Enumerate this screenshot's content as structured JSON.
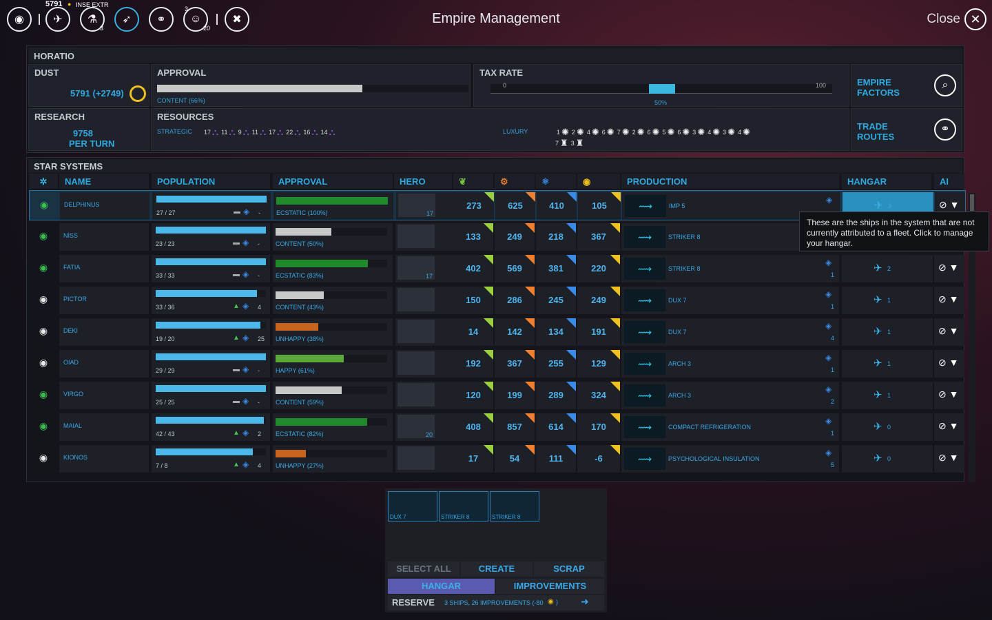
{
  "header": {
    "title": "Empire Management",
    "close_label": "Close",
    "dust_top": "5791",
    "top_tag": "INSE EXTR",
    "badge1": "3",
    "badge2": "3",
    "badge3": "20"
  },
  "empire": {
    "name": "HORATIO",
    "dust": {
      "label": "DUST",
      "value": "5791 (+2749)"
    },
    "approval": {
      "label": "APPROVAL",
      "status": "CONTENT (66%)",
      "level": 0.66
    },
    "tax": {
      "label": "TAX RATE",
      "min": "0",
      "max": "100",
      "value": "50%",
      "level": 0.5
    },
    "research": {
      "label": "RESEARCH",
      "value": "9758",
      "per_turn": "PER TURN"
    },
    "resources": {
      "label": "RESOURCES",
      "strategic_label": "STRATEGIC",
      "luxury_label": "LUXURY",
      "strategic": [
        "17",
        "11",
        "9",
        "11",
        "17",
        "22",
        "16",
        "14"
      ],
      "luxury_row1": [
        "1",
        "2",
        "4",
        "6",
        "7",
        "2",
        "6",
        "5",
        "6",
        "3",
        "4",
        "3",
        "4"
      ],
      "luxury_row2": [
        "7",
        "3"
      ]
    },
    "empire_factors": "EMPIRE FACTORS",
    "trade_routes": "TRADE ROUTES"
  },
  "systems": {
    "label": "STAR SYSTEMS",
    "columns": {
      "name": "NAME",
      "population": "POPULATION",
      "approval": "APPROVAL",
      "hero": "HERO",
      "production": "PRODUCTION",
      "hangar": "HANGAR",
      "ai": "AI"
    },
    "rows": [
      {
        "name": "DELPHINUS",
        "pop": "27 / 27",
        "pop_level": 1.0,
        "growth": "-",
        "appr": "ECSTATIC (100%)",
        "appr_level": 1.0,
        "appr_color": "#1f8a2a",
        "hero": "17",
        "food": "273",
        "industry": "625",
        "science": "410",
        "dust": "105",
        "prod": "IMP 5",
        "queue": "",
        "hangar": "3"
      },
      {
        "name": "NISS",
        "pop": "23 / 23",
        "pop_level": 1.0,
        "growth": "-",
        "appr": "CONTENT (50%)",
        "appr_level": 0.5,
        "appr_color": "#c8c8c8",
        "hero": "",
        "food": "133",
        "industry": "249",
        "science": "218",
        "dust": "367",
        "prod": "STRIKER 8",
        "queue": "",
        "hangar": ""
      },
      {
        "name": "FATIA",
        "pop": "33 / 33",
        "pop_level": 1.0,
        "growth": "-",
        "appr": "ECSTATIC (83%)",
        "appr_level": 0.83,
        "appr_color": "#1f8a2a",
        "hero": "17",
        "food": "402",
        "industry": "569",
        "science": "381",
        "dust": "220",
        "prod": "STRIKER 8",
        "queue": "1",
        "hangar": "2"
      },
      {
        "name": "PICTOR",
        "pop": "33 / 36",
        "pop_level": 0.92,
        "growth": "4",
        "appr": "CONTENT (43%)",
        "appr_level": 0.43,
        "appr_color": "#c8c8c8",
        "hero": "",
        "food": "150",
        "industry": "286",
        "science": "245",
        "dust": "249",
        "prod": "DUX 7",
        "queue": "1",
        "hangar": "1"
      },
      {
        "name": "DEKI",
        "pop": "19 / 20",
        "pop_level": 0.95,
        "growth": "25",
        "appr": "UNHAPPY (38%)",
        "appr_level": 0.38,
        "appr_color": "#c8641e",
        "hero": "",
        "food": "14",
        "industry": "142",
        "science": "134",
        "dust": "191",
        "prod": "DUX 7",
        "queue": "4",
        "hangar": "1"
      },
      {
        "name": "OIAD",
        "pop": "29 / 29",
        "pop_level": 1.0,
        "growth": "-",
        "appr": "HAPPY (61%)",
        "appr_level": 0.61,
        "appr_color": "#5ca838",
        "hero": "",
        "food": "192",
        "industry": "367",
        "science": "255",
        "dust": "129",
        "prod": "ARCH 3",
        "queue": "1",
        "hangar": "1"
      },
      {
        "name": "VIRGO",
        "pop": "25 / 25",
        "pop_level": 1.0,
        "growth": "-",
        "appr": "CONTENT (59%)",
        "appr_level": 0.59,
        "appr_color": "#c8c8c8",
        "hero": "",
        "food": "120",
        "industry": "199",
        "science": "289",
        "dust": "324",
        "prod": "ARCH 3",
        "queue": "2",
        "hangar": "1"
      },
      {
        "name": "MAIAL",
        "pop": "42 / 43",
        "pop_level": 0.98,
        "growth": "2",
        "appr": "ECSTATIC (82%)",
        "appr_level": 0.82,
        "appr_color": "#1f8a2a",
        "hero": "20",
        "food": "408",
        "industry": "857",
        "science": "614",
        "dust": "170",
        "prod": "COMPACT REFRIGERATION",
        "queue": "1",
        "hangar": "0"
      },
      {
        "name": "KIONOS",
        "pop": "7 / 8",
        "pop_level": 0.88,
        "growth": "4",
        "appr": "UNHAPPY (27%)",
        "appr_level": 0.27,
        "appr_color": "#c8641e",
        "hero": "",
        "food": "17",
        "industry": "54",
        "science": "111",
        "dust": "-6",
        "prod": "PSYCHOLOGICAL INSULATION",
        "queue": "5",
        "hangar": "0"
      }
    ]
  },
  "tooltip": "These are the ships in the system that are not currently attributed to a fleet. Click to manage your hangar.",
  "hangar_panel": {
    "slots": [
      "DUX 7",
      "STRIKER 8",
      "STRIKER 8"
    ],
    "select_all": "SELECT ALL",
    "create": "CREATE",
    "scrap": "SCRAP",
    "tab_hangar": "HANGAR",
    "tab_improvements": "IMPROVEMENTS",
    "reserve_label": "RESERVE",
    "reserve_value": "3 SHIPS, 26 IMPROVEMENTS (-80"
  }
}
